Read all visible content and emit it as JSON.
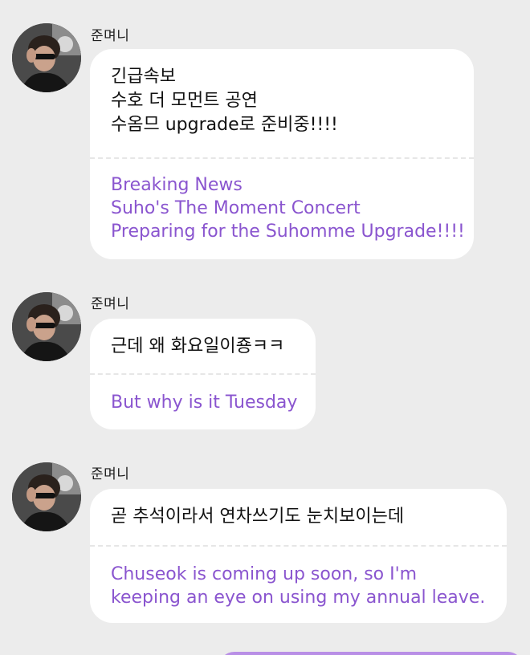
{
  "messages": [
    {
      "sender": "준며니",
      "original_lines": [
        "긴급속보",
        "수호 더 모먼트 공연",
        "수옴므 upgrade로 준비중!!!!"
      ],
      "translation_lines": [
        "Breaking News",
        "Suho's The Moment Concert",
        "Preparing for the Suhomme Upgrade!!!!"
      ]
    },
    {
      "sender": "준며니",
      "original_lines": [
        "근데 왜 화요일이죵ㅋㅋ"
      ],
      "translation_lines": [
        "But why is it Tuesday"
      ]
    },
    {
      "sender": "준며니",
      "original_lines": [
        "곧 추석이라서 연차쓰기도 눈치보이는데"
      ],
      "translation_lines": [
        "Chuseok is coming up soon, so I'm",
        "keeping an eye on using my annual leave."
      ]
    }
  ],
  "colors": {
    "background": "#ececec",
    "bubble": "#ffffff",
    "translation_text": "#8a55cf",
    "own_bubble": "#b98fe6"
  },
  "icons": {
    "avatar": "profile-photo-avatar"
  }
}
